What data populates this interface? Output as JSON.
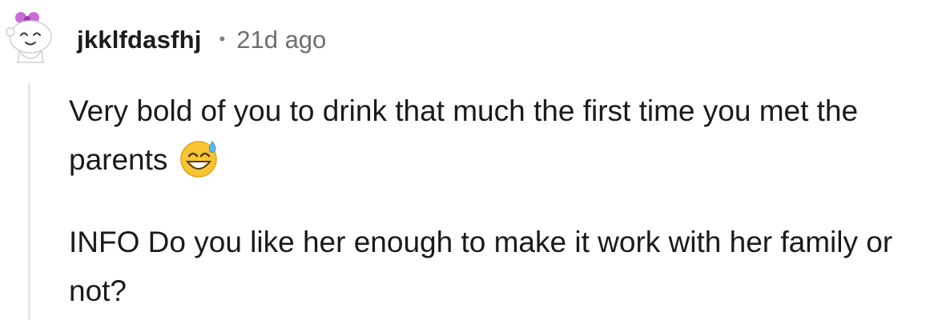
{
  "comment": {
    "author": "jkklfdasfhj",
    "separator": "•",
    "timestamp": "21d ago",
    "avatar_icon": "snoo-avatar-icon",
    "paragraphs": [
      "Very bold of you to drink that much the first time you met the parents",
      "INFO Do you like her enough to make it work with her family or not?"
    ],
    "emoji_icon": "grinning-sweat-emoji-icon"
  },
  "colors": {
    "text": "#1a1a1b",
    "meta": "#6e6e6e",
    "thread_line": "#e6e6e6",
    "avatar_accent": "#c86bd6"
  }
}
